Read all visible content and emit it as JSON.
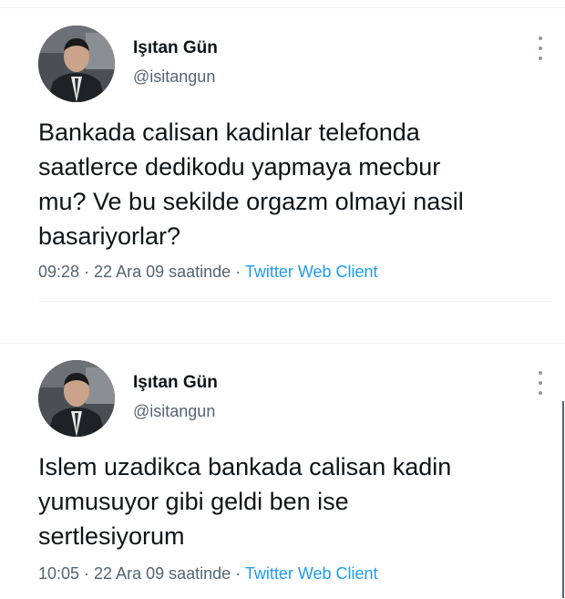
{
  "tweets": [
    {
      "name": "Işıtan Gün",
      "handle": "@isitangun",
      "lines": [
        "Bankada calisan kadinlar telefonda",
        "saatlerce dedikodu yapmaya mecbur",
        "mu? Ve bu sekilde orgazm olmayi nasil",
        "basariyorlar?"
      ],
      "time": "09:28 · 22 Ara 09 saatinde · ",
      "client": "Twitter Web Client",
      "more_icon": "vertical-ellipsis-icon"
    },
    {
      "name": "Işıtan Gün",
      "handle": "@isitangun",
      "lines": [
        "Islem uzadikca bankada calisan kadin",
        "yumusuyor gibi geldi ben ise",
        "sertlesiyorum"
      ],
      "time": "10:05 · 22 Ara 09 saatinde · ",
      "client": "Twitter Web Client",
      "more_icon": "vertical-ellipsis-icon"
    }
  ],
  "colors": {
    "text": "#0f1419",
    "secondary": "#536471",
    "link": "#1d9bf0",
    "divider": "#eff3f4"
  }
}
